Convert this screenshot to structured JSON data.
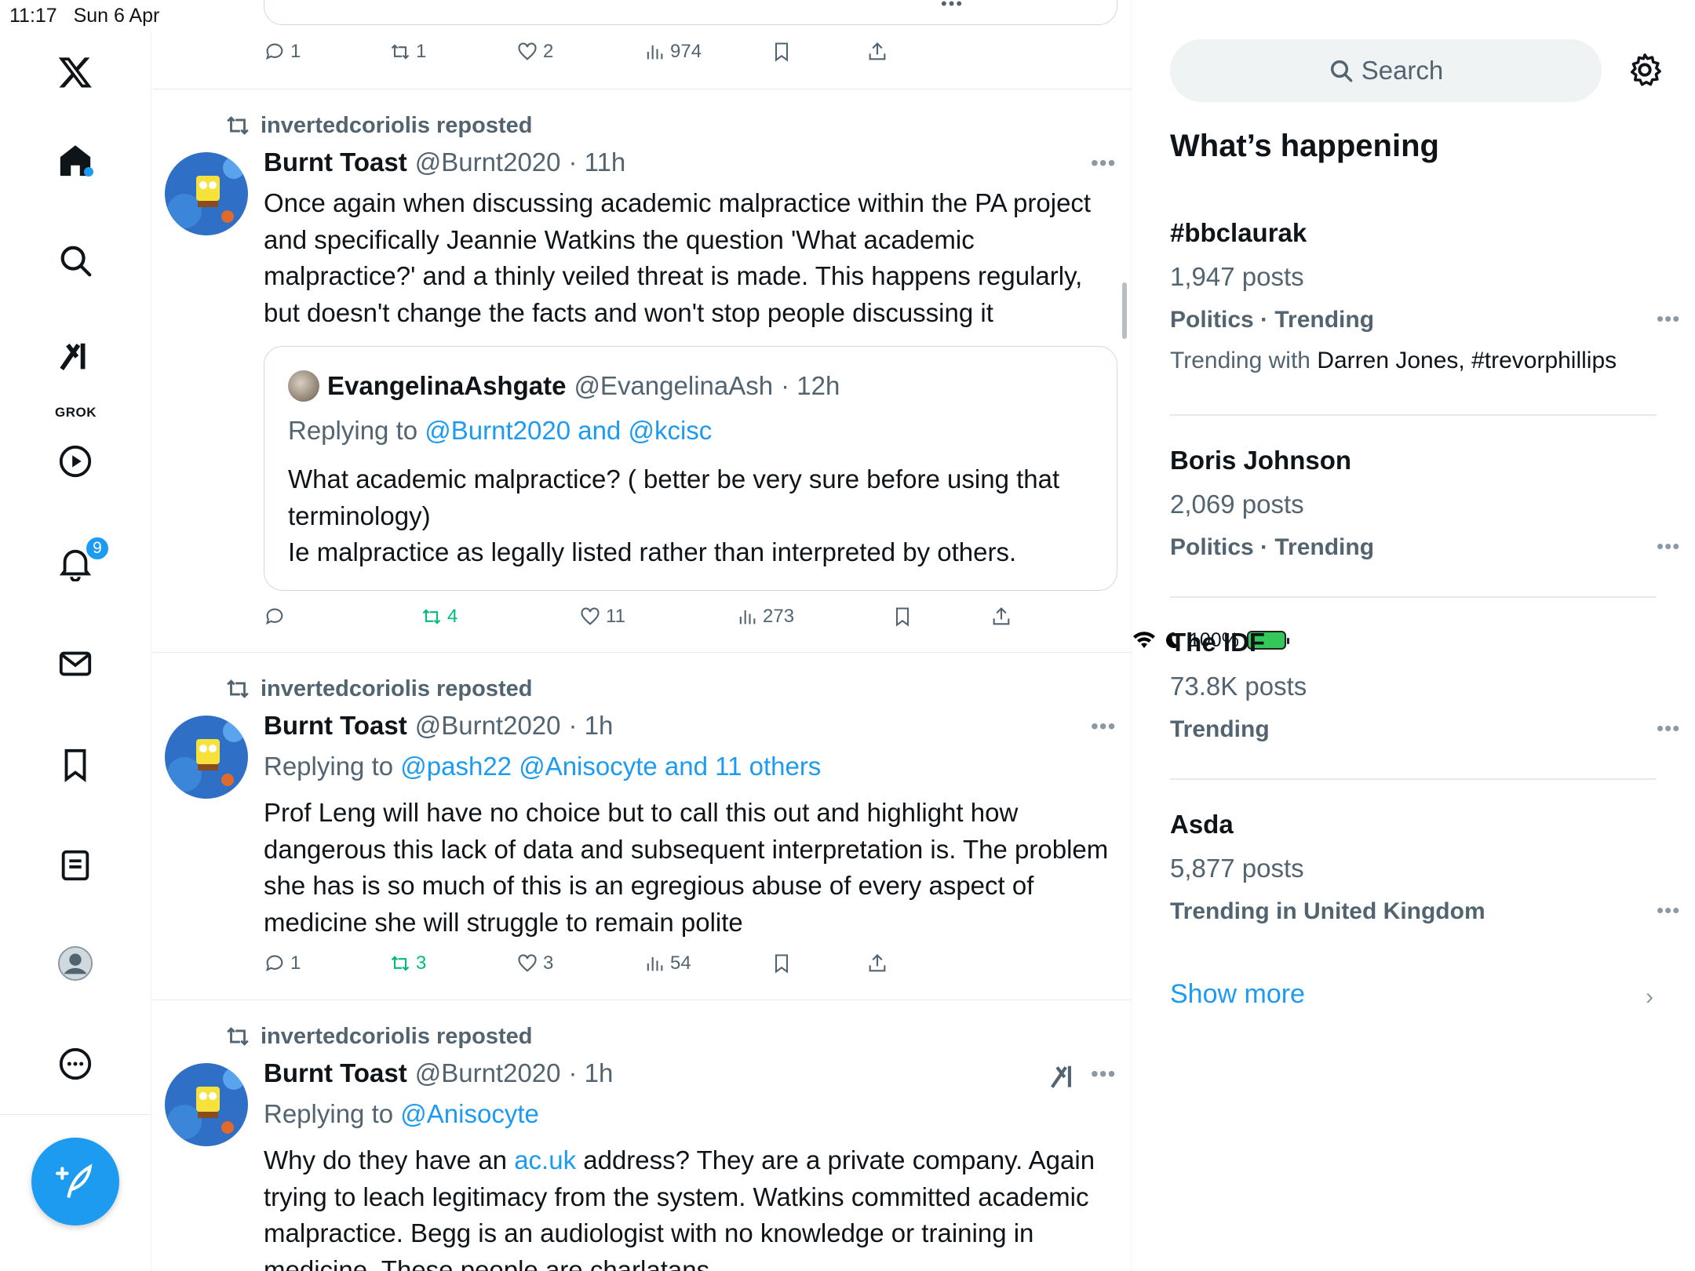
{
  "status": {
    "time": "11:17",
    "date": "Sun 6 Apr",
    "battery": "100%"
  },
  "nav": {
    "grok_label": "GROK",
    "notifications_count": "9"
  },
  "top_actions": {
    "reply": "1",
    "repost": "1",
    "like": "2",
    "views": "974"
  },
  "posts": [
    {
      "repost_by": "invertedcoriolis reposted",
      "name": "Burnt Toast",
      "handle": "@Burnt2020",
      "time": "· 11h",
      "text": "Once again when discussing academic malpractice within the PA project and specifically Jeannie Watkins the question 'What academic malpractice?' and a thinly veiled threat is made. This happens regularly, but doesn't change the facts and won't stop people discussing it",
      "quote": {
        "name": "EvangelinaAshgate",
        "handle": "@EvangelinaAsh",
        "time": "· 12h",
        "replying_prefix": "Replying to ",
        "replying_to": "@Burnt2020 and @kcisc",
        "text_line1": "What academic malpractice? ( better be very sure before using that terminology)",
        "text_line2": "Ie malpractice as legally listed rather than interpreted by others."
      },
      "actions": {
        "reply": "",
        "repost": "4",
        "like": "11",
        "views": "273"
      }
    },
    {
      "repost_by": "invertedcoriolis reposted",
      "name": "Burnt Toast",
      "handle": "@Burnt2020",
      "time": "· 1h",
      "replying_prefix": "Replying to ",
      "replying_to": "@pash22 @Anisocyte and 11 others",
      "text": "Prof Leng will have no choice but to call this out and highlight how dangerous this lack of data and subsequent interpretation is. The problem she has is so much of this is an egregious abuse of every aspect of medicine she will struggle to remain polite",
      "actions": {
        "reply": "1",
        "repost": "3",
        "like": "3",
        "views": "54"
      }
    },
    {
      "repost_by": "invertedcoriolis reposted",
      "name": "Burnt Toast",
      "handle": "@Burnt2020",
      "time": "· 1h",
      "replying_prefix": "Replying to ",
      "replying_to": "@Anisocyte",
      "text_pre": "Why do they have an ",
      "text_link": "ac.uk",
      "text_post": " address? They are a private company. Again trying to leach legitimacy from the system. Watkins committed academic malpractice. Begg is an audiologist with no knowledge or training in medicine. These people are charlatans"
    }
  ],
  "sidebar": {
    "search_placeholder": "Search",
    "whats_happening": "What’s happening",
    "trends": [
      {
        "name": "#bbclaurak",
        "count": "1,947 posts",
        "category": "Politics · Trending",
        "with_prefix": "Trending with ",
        "with_names": "Darren Jones, #trevorphillips"
      },
      {
        "name": "Boris Johnson",
        "count": "2,069 posts",
        "category": "Politics · Trending"
      },
      {
        "name": "The IDF",
        "count": "73.8K posts",
        "category": "Trending"
      },
      {
        "name": "Asda",
        "count": "5,877 posts",
        "category": "Trending in United Kingdom"
      }
    ],
    "show_more": "Show more"
  },
  "colors": {
    "accent": "#1d9bf0",
    "repost_green": "#00ba7c",
    "muted": "#536471"
  }
}
